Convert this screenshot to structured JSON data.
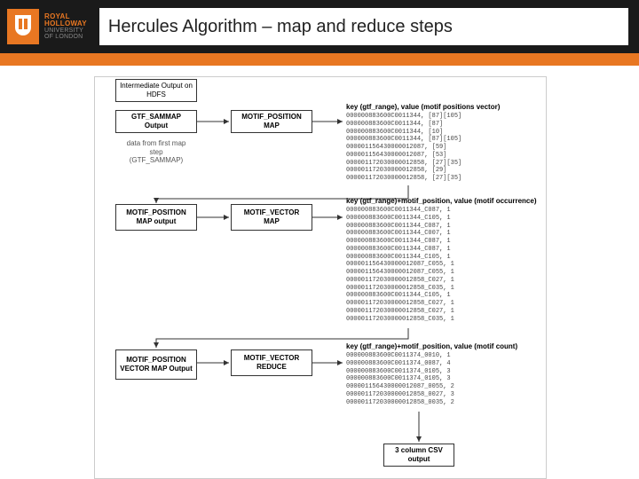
{
  "header": {
    "institution": {
      "l1": "ROYAL",
      "l2": "HOLLOWAY",
      "l3": "UNIVERSITY",
      "l4": "OF LONDON"
    },
    "title": "Hercules Algorithm – map and reduce steps"
  },
  "boxes": {
    "hdfs": "Intermediate Output\non HDFS",
    "gtf_sammap": "GTF_SAMMAP\nOutput",
    "motif_position_map": "MOTIF_POSITION\nMAP",
    "motif_position_map_output": "MOTIF_POSITION\nMAP output",
    "motif_vector_map": "MOTIF_VECTOR\nMAP",
    "motif_position_vector_map_output": "MOTIF_POSITION\nVECTOR MAP\nOutput",
    "motif_vector_reduce": "MOTIF_VECTOR\nREDUCE",
    "csv_output": "3 column\nCSV output"
  },
  "note": "data from first\nmap step\n(GTF_SAMMAP)",
  "block1": {
    "header": "key (gtf_range), value (motif positions vector)",
    "lines": [
      "000000883600C0011344, [87][105]",
      "000000883600C0011344, [87]",
      "000000883600C0011344, [10]",
      "000000883600C0011344, [87][105]",
      "000001156430000012087, [59]",
      "000001156430000012087, [53]",
      "000001172030000012858, [27][35]",
      "000001172030000012858, [29]",
      "000001172030000012858, [27][35]"
    ]
  },
  "block2": {
    "header": "key (gtf_range)+motif_position, value (motif occurrence)",
    "lines": [
      "000000883600C0011344_C087, 1",
      "000000883600C0011344_C105, 1",
      "000000883600C0011344_C087, 1",
      "000000883600C0011344_C007, 1",
      "000000883600C0011344_C087, 1",
      "000000883600C0011344_C087, 1",
      "000000883600C0011344_C105, 1",
      "000001156430000012087_C055, 1",
      "000001156430000012087_C055, 1",
      "000001172030000012858_C027, 1",
      "000001172030000012858_C035, 1",
      "000000883600C0011344_C105, 1",
      "000001172030000012858_C027, 1",
      "000001172030000012858_C027, 1",
      "000001172030000012858_C035, 1"
    ]
  },
  "block3": {
    "header": "key (gtf_range)+motif_position, value (motif count)",
    "lines": [
      "000000883600C0011374_0010, 1",
      "000000883600C0011374_0087, 4",
      "000000883600C0011374_0105, 3",
      "000000883600C0011374_0105, 3",
      "000001156430000012087_0055, 2",
      "000001172030000012858_0027, 3",
      "000001172030000012858_0035, 2"
    ]
  }
}
